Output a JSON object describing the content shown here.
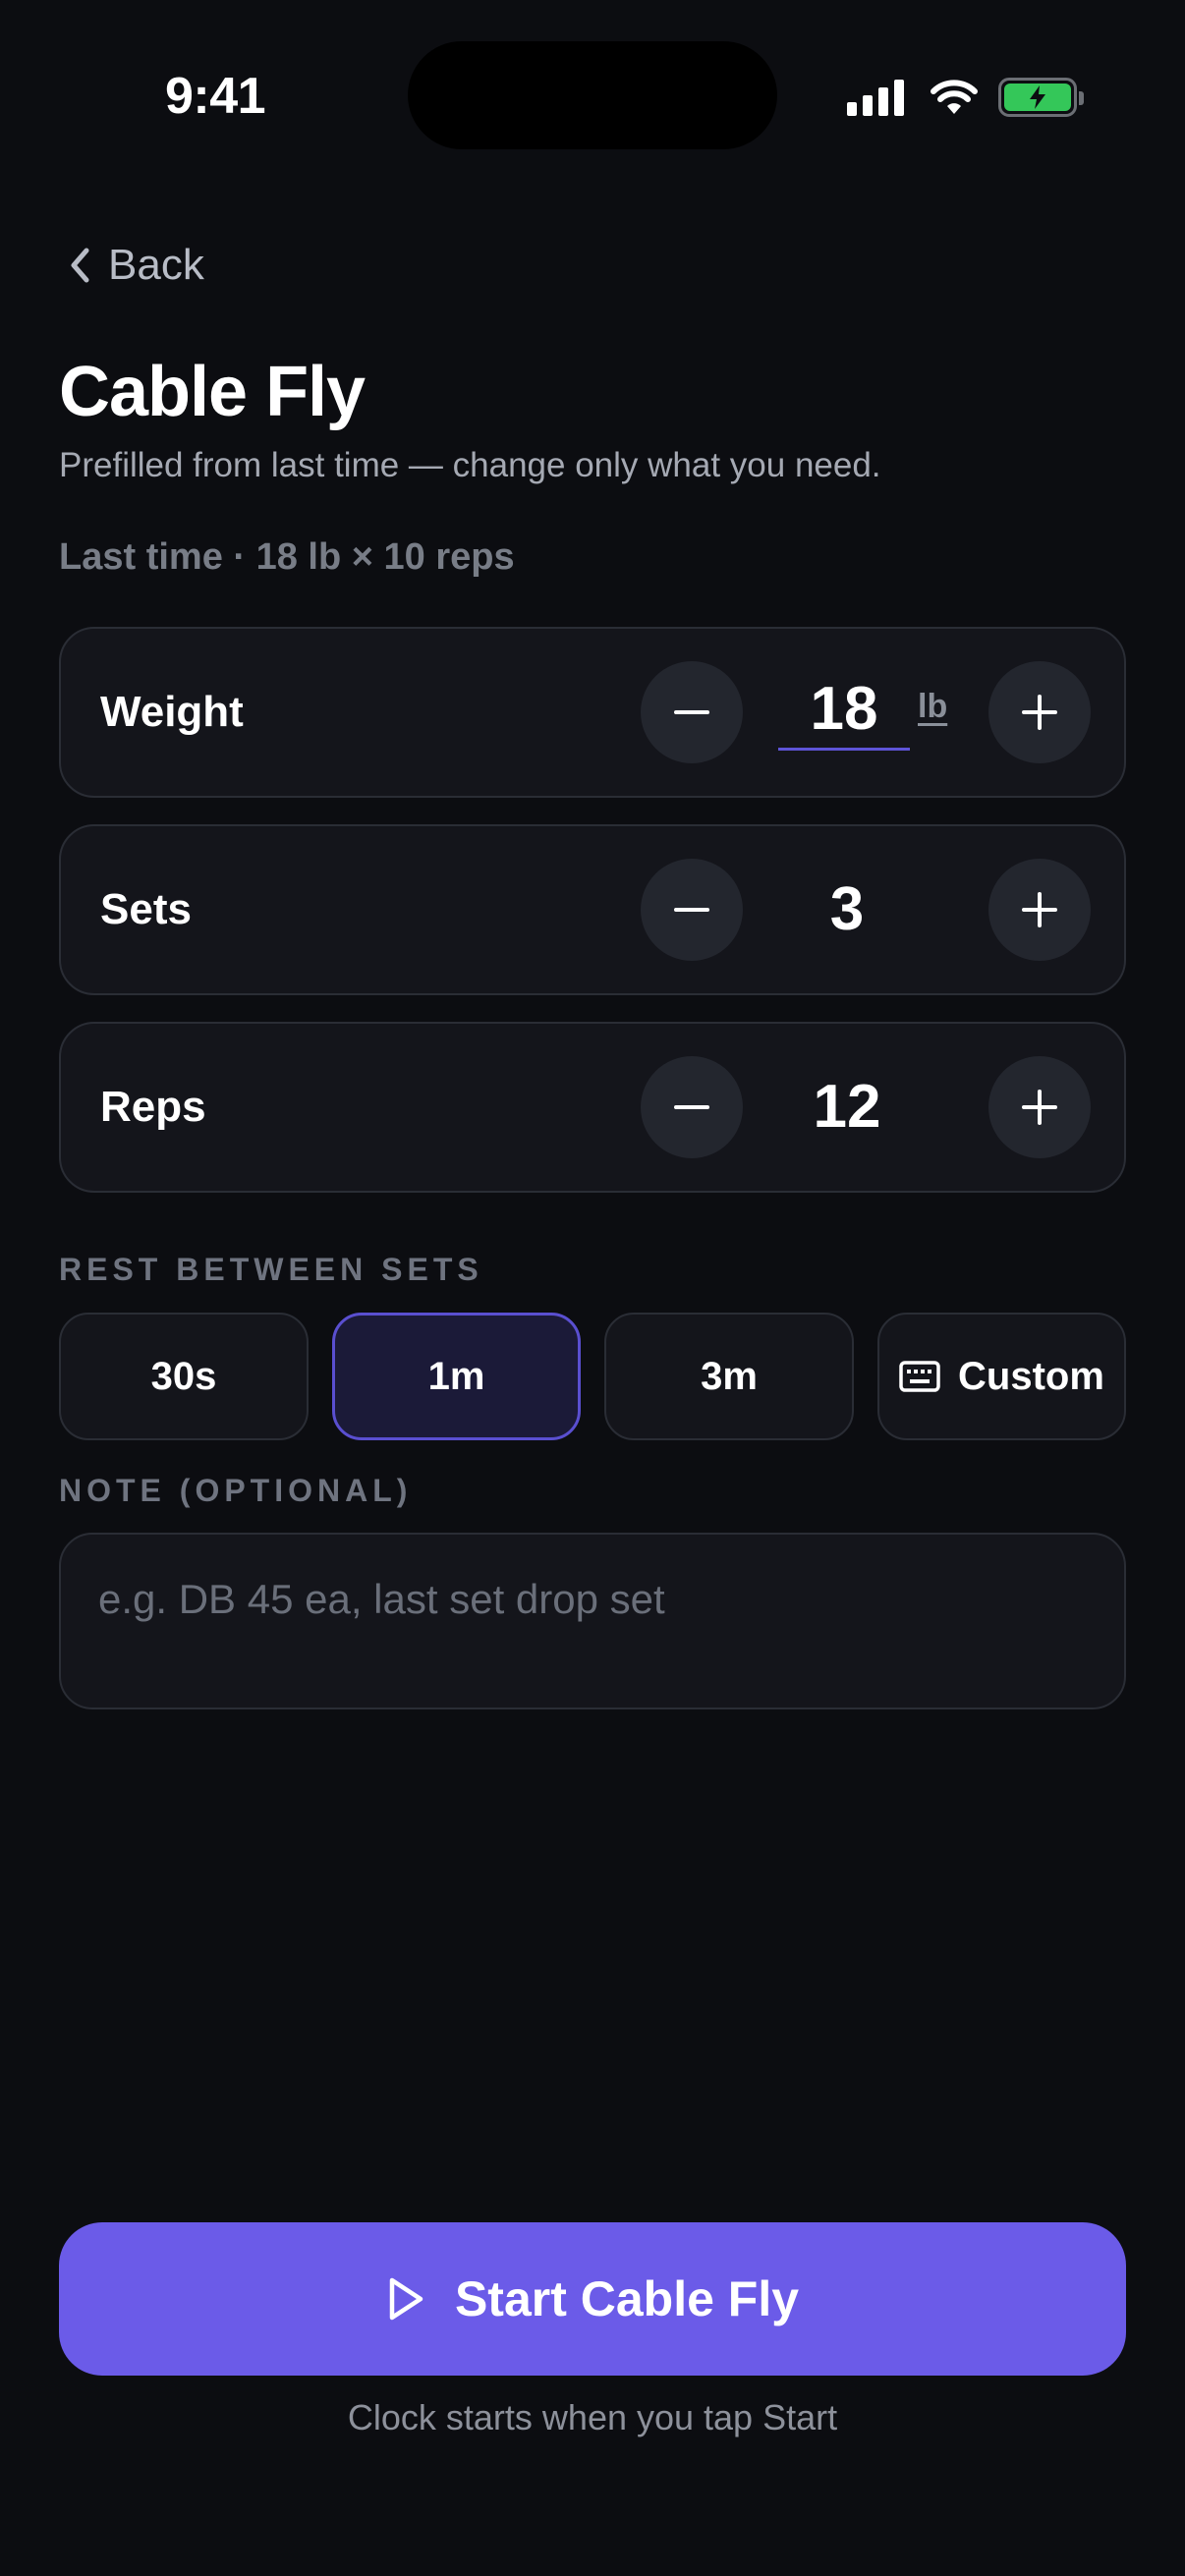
{
  "status_bar": {
    "time": "9:41"
  },
  "nav": {
    "back_label": "Back"
  },
  "header": {
    "title": "Cable Fly",
    "subtitle": "Prefilled from last time — change only what you need.",
    "last_time": "Last time · 18 lb × 10 reps"
  },
  "steppers": {
    "weight": {
      "label": "Weight",
      "value": "18",
      "unit": "lb"
    },
    "sets": {
      "label": "Sets",
      "value": "3"
    },
    "reps": {
      "label": "Reps",
      "value": "12"
    }
  },
  "rest": {
    "label": "REST BETWEEN SETS",
    "options": [
      {
        "label": "30s",
        "selected": false
      },
      {
        "label": "1m",
        "selected": true
      },
      {
        "label": "3m",
        "selected": false
      },
      {
        "label": "Custom",
        "selected": false,
        "icon": "keyboard-icon"
      }
    ]
  },
  "note": {
    "label": "NOTE (OPTIONAL)",
    "value": "",
    "placeholder": "e.g. DB 45 ea, last set drop set"
  },
  "start": {
    "label": "Start Cable Fly",
    "hint": "Clock starts when you tap Start",
    "icon": "play-icon"
  },
  "colors": {
    "background": "#0c0d11",
    "card": "#14151b",
    "accent": "#6b5be8",
    "selected_bg": "#1b1a38",
    "battery": "#34c759"
  }
}
